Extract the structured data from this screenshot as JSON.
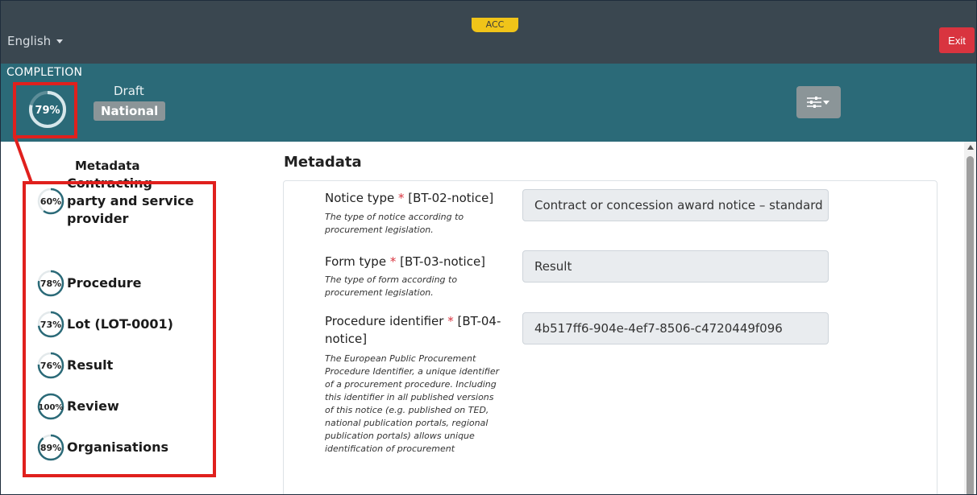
{
  "topbar": {
    "language": "English",
    "env_badge": "ACC",
    "exit_label": "Exit"
  },
  "completion": {
    "label": "COMPLETION",
    "percent": 79,
    "percent_label": "79%",
    "status": "Draft",
    "scope_badge": "National"
  },
  "sidebar": {
    "metadata_label": "Metadata",
    "items": [
      {
        "label": "Contracting party and service provider",
        "percent": 60,
        "percent_label": "60%"
      },
      {
        "label": "Procedure",
        "percent": 78,
        "percent_label": "78%"
      },
      {
        "label": "Lot (LOT-0001)",
        "percent": 73,
        "percent_label": "73%"
      },
      {
        "label": "Result",
        "percent": 76,
        "percent_label": "76%"
      },
      {
        "label": "Review",
        "percent": 100,
        "percent_label": "100%"
      },
      {
        "label": "Organisations",
        "percent": 89,
        "percent_label": "89%"
      }
    ]
  },
  "main": {
    "title": "Metadata",
    "fields": [
      {
        "label": "Notice type",
        "code": "[BT-02-notice]",
        "description": "The type of notice according to procurement legislation.",
        "value": "Contract or concession award notice – standard"
      },
      {
        "label": "Form type",
        "code": "[BT-03-notice]",
        "description": "The type of form according to procurement legislation.",
        "value": "Result"
      },
      {
        "label": "Procedure identifier",
        "code": "[BT-04-notice]",
        "description": "The European Public Procurement Procedure Identifier, a unique identifier of a procurement procedure. Including this identifier in all published versions of this notice (e.g. published on TED, national publication portals, regional publication portals) allows unique identification of procurement",
        "value": "4b517ff6-904e-4ef7-8506-c4720449f096"
      }
    ]
  },
  "colors": {
    "topbar": "#3a4750",
    "completion_bar": "#2b6a78",
    "gauge_ring": "#2b6a78",
    "exit": "#d9343f",
    "env_badge": "#f0c419",
    "annotation": "#e0201d"
  },
  "icons": {
    "settings": "sliders-icon",
    "language_dropdown": "caret-down-icon"
  }
}
